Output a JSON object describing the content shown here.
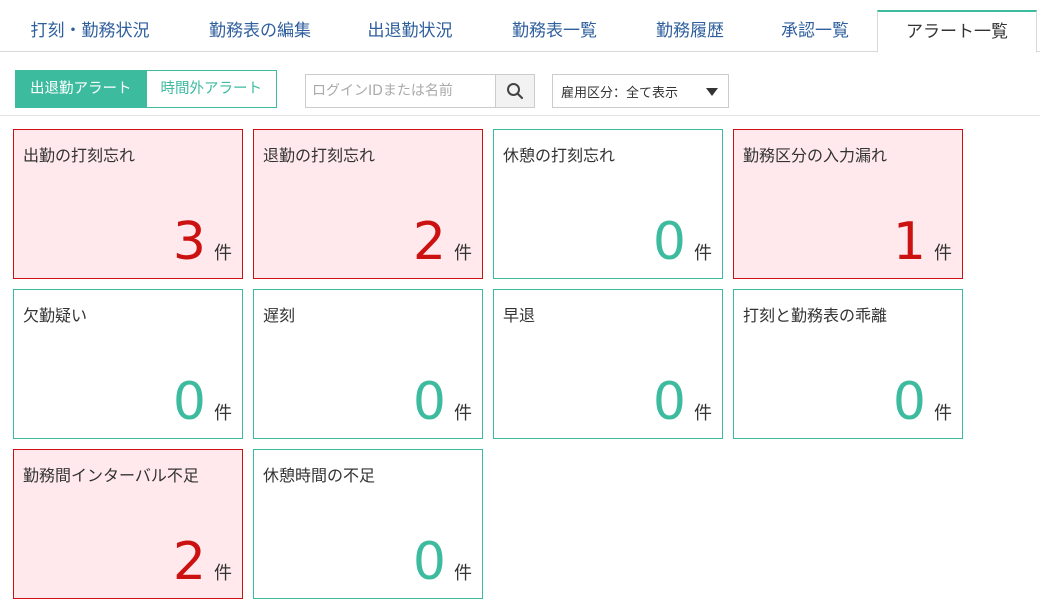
{
  "tabs": [
    {
      "label": "打刻・勤務状況",
      "active": false
    },
    {
      "label": "勤務表の編集",
      "active": false
    },
    {
      "label": "出退勤状況",
      "active": false
    },
    {
      "label": "勤務表一覧",
      "active": false
    },
    {
      "label": "勤務履歴",
      "active": false
    },
    {
      "label": "承認一覧",
      "active": false
    },
    {
      "label": "アラート一覧",
      "active": true
    }
  ],
  "toolbar": {
    "seg_attendance": "出退勤アラート",
    "seg_overtime": "時間外アラート",
    "search_placeholder": "ログインIDまたは名前",
    "search_value": "",
    "employment_select": "雇用区分：全て表示"
  },
  "colors": {
    "accent": "#3dbb9f",
    "alert": "#cc1111",
    "alert_bg": "#ffe9ec",
    "link": "#2f5f9e"
  },
  "icons": {
    "search": "search-icon",
    "dropdown": "caret-down-icon"
  },
  "cards": [
    {
      "title": "出勤の打刻忘れ",
      "count": "3",
      "unit": "件",
      "state": "alert"
    },
    {
      "title": "退勤の打刻忘れ",
      "count": "2",
      "unit": "件",
      "state": "alert"
    },
    {
      "title": "休憩の打刻忘れ",
      "count": "0",
      "unit": "件",
      "state": "ok"
    },
    {
      "title": "勤務区分の入力漏れ",
      "count": "1",
      "unit": "件",
      "state": "alert"
    },
    {
      "title": "欠勤疑い",
      "count": "0",
      "unit": "件",
      "state": "ok"
    },
    {
      "title": "遅刻",
      "count": "0",
      "unit": "件",
      "state": "ok"
    },
    {
      "title": "早退",
      "count": "0",
      "unit": "件",
      "state": "ok"
    },
    {
      "title": "打刻と勤務表の乖離",
      "count": "0",
      "unit": "件",
      "state": "ok"
    },
    {
      "title": "勤務間インターバル不足",
      "count": "2",
      "unit": "件",
      "state": "alert"
    },
    {
      "title": "休憩時間の不足",
      "count": "0",
      "unit": "件",
      "state": "ok"
    }
  ]
}
